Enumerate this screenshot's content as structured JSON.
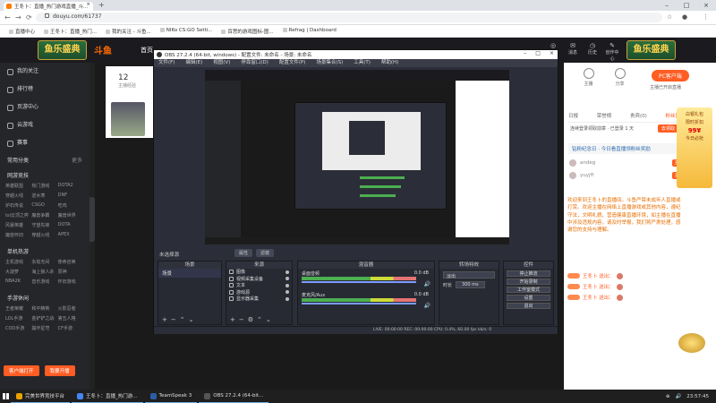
{
  "browser": {
    "tab_title": "王冬卜：直播_热门游戏直播_斗...",
    "url": "douyu.com/61737",
    "bookmarks": [
      "直播中心",
      "王冬卜：直播_热门...",
      "我的关注 - 斗鱼...",
      "NIKo CS:GO Setti...",
      "百思的游戏图标-图...",
      "Refrag | Dashboard"
    ]
  },
  "site": {
    "logo_left": "鱼乐盛典",
    "brand": "斗鱼",
    "nav_home": "首页",
    "logo_right": "鱼乐盛典",
    "header_icons": [
      "超级",
      "消息",
      "历史",
      "创作中心"
    ]
  },
  "sidebar": {
    "items": [
      "我的关注",
      "排行榜",
      "页游中心",
      "云游戏",
      "赛事"
    ],
    "section1": {
      "title": "常用分类",
      "more": "更多"
    },
    "section2": {
      "title": "网游竞技",
      "grid": [
        "英雄联盟",
        "热门游戏",
        "DOTA2",
        "穿越火线",
        "逆水寒",
        "DNF",
        "炉石传说",
        "CSGO",
        "吃鸡",
        "lol云顶之弈",
        "魔兽争霸",
        "魔兽世界",
        "风暴英雄",
        "守望先锋",
        "DOTA",
        "魔兽怀旧",
        "穿越火线",
        "APEX"
      ]
    },
    "section3": {
      "title": "单机热游",
      "grid": [
        "主机游戏",
        "永劫无间",
        "使命召唤",
        "大菠萝",
        "海上狼人杀",
        "原神",
        "NBA2K",
        "音乐游戏",
        "怀旧游戏"
      ]
    },
    "section4": {
      "title": "手游休闲",
      "grid": [
        "王者荣耀",
        "和平精英",
        "火影忍者",
        "LOL手游",
        "金铲铲之战",
        "第五人格",
        "COD手游",
        "崩坏星穹",
        "CF手游"
      ]
    },
    "btn_open": "客户端打开",
    "btn_live": "我要开播"
  },
  "anchor": {
    "count": "12",
    "count_label": "主播经验"
  },
  "obs": {
    "title": "OBS 27.2.4 (64-bit, windows) - 配置文件: 未命名 - 场景: 未命名",
    "menu": [
      "文件(F)",
      "编辑(E)",
      "视图(V)",
      "停靠窗口(D)",
      "配置文件(P)",
      "场景集合(S)",
      "工具(T)",
      "帮助(H)"
    ],
    "no_source": "未选择源",
    "props_btn": "属性",
    "filters_btn": "滤镜",
    "docks": {
      "scenes": "场景",
      "sources": "来源",
      "mixer": "混音器",
      "transitions": "转场特效",
      "controls": "控件"
    },
    "scenes": [
      "场景"
    ],
    "sources": [
      "图像",
      "视频采集设备",
      "文本",
      "游戏源",
      "显示器采集"
    ],
    "mixer": [
      {
        "name": "桌面音频",
        "db": "0.0 dB"
      },
      {
        "name": "麦克风/Aux",
        "db": "0.0 dB"
      },
      {
        "name": "桌面音频",
        "db": "0.0 dB"
      }
    ],
    "transition": {
      "type": "淡出",
      "duration_label": "时长",
      "duration": "300 ms"
    },
    "controls": [
      "停止推流",
      "开始录制",
      "工作室模式",
      "设置",
      "退出"
    ],
    "status": "LIVE: 00:00:00   REC: 00:00:00   CPU: 0.4%, 60.00 fps   kb/s: 0"
  },
  "right": {
    "icons": [
      "主播",
      "分享",
      "举报"
    ],
    "pc_btn": "PC客户端",
    "pc_sub": "主播已开启直播",
    "tabs": [
      "日报",
      "荣誉榜",
      "贵宾(0)",
      "粉丝团"
    ],
    "rank_text": "连续登录领取勋章 · 已登录 1 天",
    "rank_btn": "去领取",
    "fans_text": "钻粉纪念日 · 今日看直播领粉丝奖励",
    "chat": [
      {
        "user": "andeg",
        "badge": "王中王"
      },
      {
        "user": "yuyjff",
        "badge": "王中王"
      }
    ],
    "welcome": "欢迎来到王冬卜的直播间。斗鱼严禁未成年人直播或打赏。欢迎主播在网络上直播游戏或其他内容，遵纪守法，文明礼貌，营造健康直播环境，如主播在直播中涉及违规内容，请及时举报，我们将严肃处理，感谢您的支持与理解。",
    "gift_lines": [
      "王冬卜 送出：",
      "王冬卜 送出：",
      "王冬卜 送出："
    ]
  },
  "promo": {
    "l1": "白银礼包",
    "l2": "限时折扣",
    "l3": "99¥",
    "l4": "今日必抢"
  },
  "taskbar": {
    "items": [
      "完美世界竞技平台",
      "王冬卜：直播_热门游...",
      "TeamSpeak 3",
      "OBS 27.2.4 (64-bit..."
    ],
    "clock": "23:57:45"
  }
}
